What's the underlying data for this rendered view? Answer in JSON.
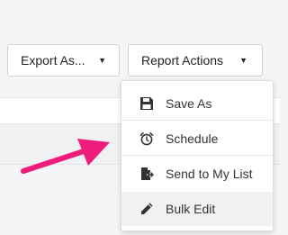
{
  "toolbar": {
    "export_label": "Export As...",
    "report_label": "Report Actions",
    "caret_icon": "caret-down-icon"
  },
  "report_menu": {
    "items": [
      {
        "label": "Save As",
        "icon": "save-icon"
      },
      {
        "label": "Schedule",
        "icon": "alarm-clock-icon"
      },
      {
        "label": "Send to My List",
        "icon": "document-export-icon"
      },
      {
        "label": "Bulk Edit",
        "icon": "pencil-icon"
      }
    ],
    "highlighted_item": "Bulk Edit"
  },
  "annotation": {
    "type": "pointer-arrow",
    "color": "#ee1c7a"
  }
}
